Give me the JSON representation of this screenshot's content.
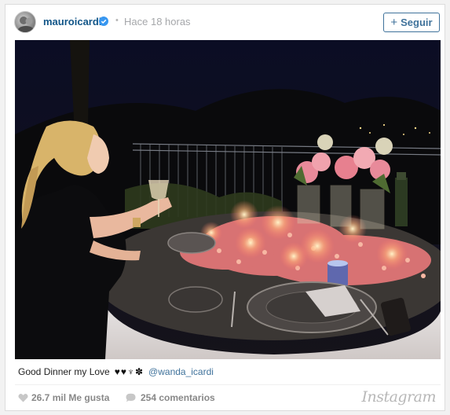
{
  "post": {
    "username": "mauroicardi",
    "verified": true,
    "separator": "•",
    "time": "Hace 18 horas",
    "follow_label": "Seguir",
    "caption": {
      "text": "Good Dinner my Love",
      "emoji": "♥♥♆✽",
      "mention": "@wanda_icardi"
    },
    "likes": "26.7 mil Me gusta",
    "comments": "254 comentarios",
    "brand": "Instagram"
  },
  "icons": {
    "avatar": "profile-avatar",
    "verified": "verified-badge-icon",
    "follow": "plus-icon",
    "likes": "heart-icon",
    "comments": "comment-bubble-icon"
  },
  "colors": {
    "username": "#125688",
    "follow_border": "#3f729b",
    "verified": "#3897f0",
    "muted": "#a5a7aa"
  }
}
